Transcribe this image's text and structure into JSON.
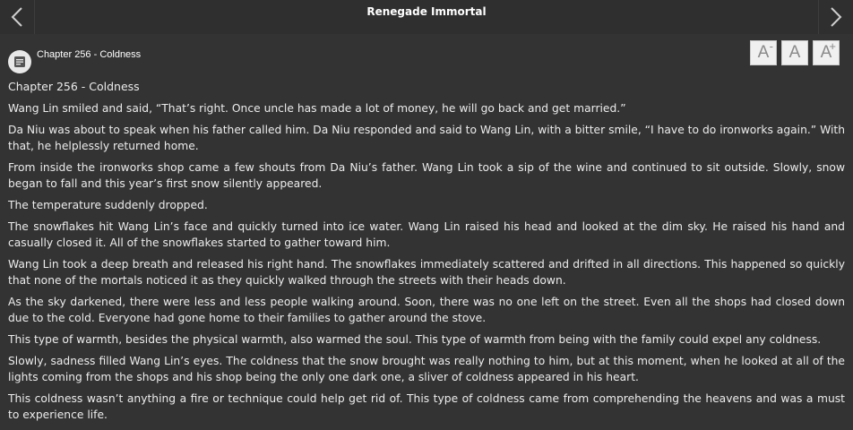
{
  "header": {
    "title": "Renegade Immortal",
    "prev_icon": "chevron-left-icon",
    "next_icon": "chevron-right-icon"
  },
  "chapter_header": {
    "icon": "document-icon",
    "title": "Chapter 256 - Coldness"
  },
  "font_controls": {
    "decrease": {
      "label": "A",
      "sup": "-"
    },
    "reset": {
      "label": "A"
    },
    "increase": {
      "label": "A",
      "sup": "+"
    }
  },
  "content": {
    "heading": "Chapter 256 - Coldness",
    "paragraphs": [
      "Wang Lin smiled and said, “That’s right. Once uncle has made a lot of money, he will go back and get married.”",
      "Da Niu was about to speak when his father called him. Da Niu responded and said to Wang Lin, with a bitter smile, “I have to do ironworks again.” With that, he helplessly returned home.",
      "From inside the ironworks shop came a few shouts from Da Niu’s father. Wang Lin took a sip of the wine and continued to sit outside. Slowly, snow began to fall and this year’s first snow silently appeared.",
      "The temperature suddenly dropped.",
      "The snowflakes hit Wang Lin’s face and quickly turned into ice water. Wang Lin raised his head and looked at the dim sky. He raised his hand and casually closed it. All of the snowflakes started to gather toward him.",
      "Wang Lin took a deep breath and released his right hand. The snowflakes immediately scattered and drifted in all directions. This happened so quickly that none of the mortals noticed it as they quickly walked through the streets with their heads down.",
      "As the sky darkened, there were less and less people walking around. Soon, there was no one left on the street. Even all the shops had closed down due to the cold. Everyone had gone home to their families to gather around the stove.",
      "This type of warmth, besides the physical warmth, also warmed the soul. This type of warmth from being with the family could expel any coldness.",
      "Slowly, sadness filled Wang Lin’s eyes. The coldness that the snow brought was really nothing to him, but at this moment, when he looked at all of the lights coming from the shops and his shop being the only one dark one, a sliver of coldness appeared in his heart.",
      "This coldness wasn’t anything a fire or technique could help get rid of. This type of coldness came from comprehending the heavens and was a must to experience life."
    ]
  }
}
